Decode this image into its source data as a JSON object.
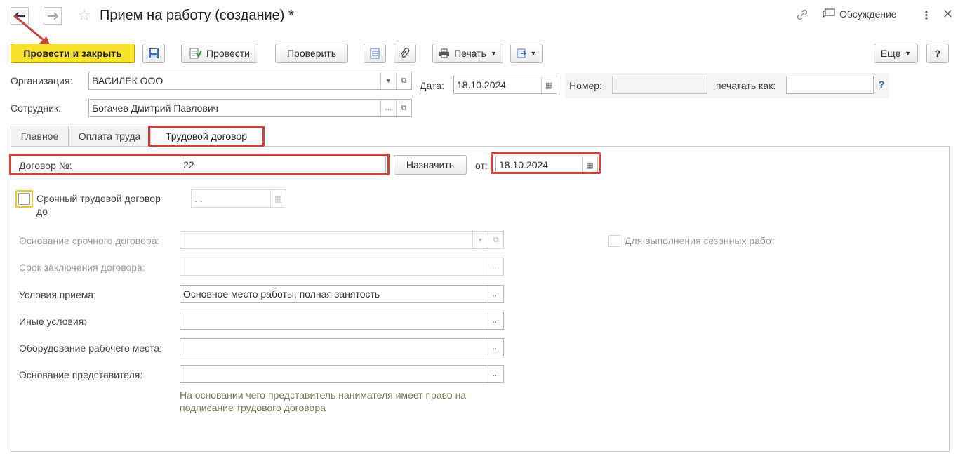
{
  "window": {
    "title": "Прием на работу (создание) *",
    "discussion_label": "Обсуждение"
  },
  "toolbar": {
    "post_close_label": "Провести и закрыть",
    "post_label": "Провести",
    "check_label": "Проверить",
    "print_label": "Печать",
    "more_label": "Еще",
    "help_label": "?"
  },
  "header": {
    "org_label": "Организация:",
    "org_value": "ВАСИЛЕК ООО",
    "date_label": "Дата:",
    "date_value": "18.10.2024",
    "number_label": "Номер:",
    "number_value": "",
    "print_as_label": "печатать как:",
    "print_as_value": "",
    "help_q": "?",
    "employee_label": "Сотрудник:",
    "employee_value": "Богачев Дмитрий Павлович"
  },
  "tabs": [
    {
      "label": "Главное"
    },
    {
      "label": "Оплата труда"
    },
    {
      "label": "Трудовой договор"
    }
  ],
  "contract": {
    "number_label": "Договор №:",
    "number_value": "22",
    "assign_label": "Назначить",
    "from_label": "от:",
    "from_value": "18.10.2024",
    "fixed_term_label_1": "Срочный трудовой договор",
    "fixed_term_label_2": "до",
    "fixed_term_date": " .  .",
    "basis_label": "Основание срочного договора:",
    "seasonal_label": "Для выполнения сезонных работ",
    "term_label": "Срок заключения договора:",
    "conditions_label": "Условия приема:",
    "conditions_value": "Основное место работы, полная занятость",
    "other_label": "Иные условия:",
    "equipment_label": "Оборудование рабочего места:",
    "rep_basis_label": "Основание представителя:",
    "rep_hint_1": "На основании чего представитель нанимателя имеет право на",
    "rep_hint_2": "подписание трудового договора"
  },
  "colors": {
    "primary_button": "#f7e12a",
    "highlight": "#d0413a"
  }
}
